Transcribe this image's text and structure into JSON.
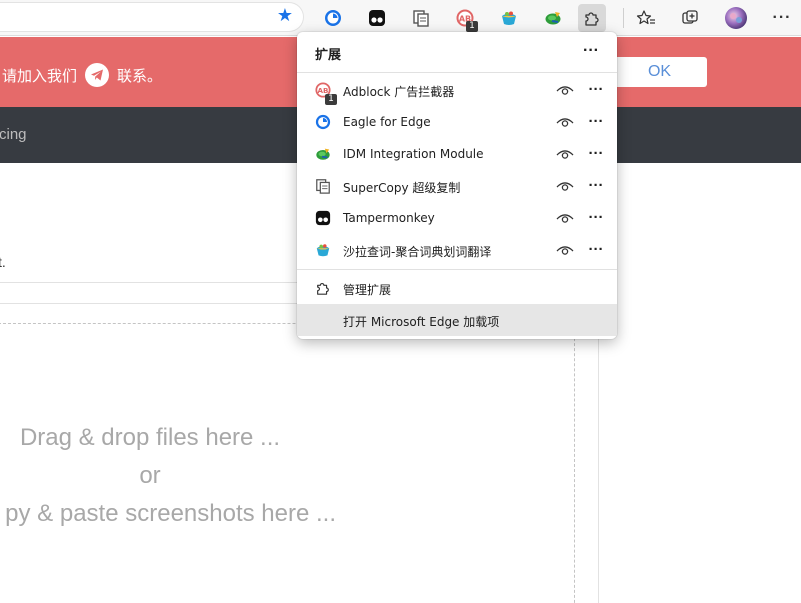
{
  "banner": {
    "text_before": "请加入我们",
    "text_after": "联系。",
    "ok_label": "OK"
  },
  "navbar": {
    "text": "cing"
  },
  "content": {
    "fragment": "t.",
    "drop_line1": "Drag & drop files here ...",
    "drop_line2": "or",
    "drop_line3": "py & paste screenshots here ..."
  },
  "toolbar": {
    "pinned_extensions": [
      "eagle-icon",
      "tampermonkey-icon",
      "supercopy-icon",
      "adblock-icon",
      "shaladict-icon",
      "idm-icon"
    ],
    "adblock_badge": "1"
  },
  "extensions_menu": {
    "title": "扩展",
    "items": [
      {
        "name": "Adblock 广告拦截器",
        "icon": "adblock-icon",
        "badge": "1"
      },
      {
        "name": "Eagle for Edge",
        "icon": "eagle-icon"
      },
      {
        "name": "IDM Integration Module",
        "icon": "idm-icon"
      },
      {
        "name": "SuperCopy 超级复制",
        "icon": "supercopy-icon"
      },
      {
        "name": "Tampermonkey",
        "icon": "tampermonkey-icon"
      },
      {
        "name": "沙拉查词-聚合词典划词翻译",
        "icon": "shaladict-icon"
      }
    ],
    "manage_label": "管理扩展",
    "open_addons_label": "打开 Microsoft Edge 加载项"
  },
  "colors": {
    "banner": "#e56a6a",
    "navbar": "#373b41",
    "accent": "#1a73e8"
  }
}
